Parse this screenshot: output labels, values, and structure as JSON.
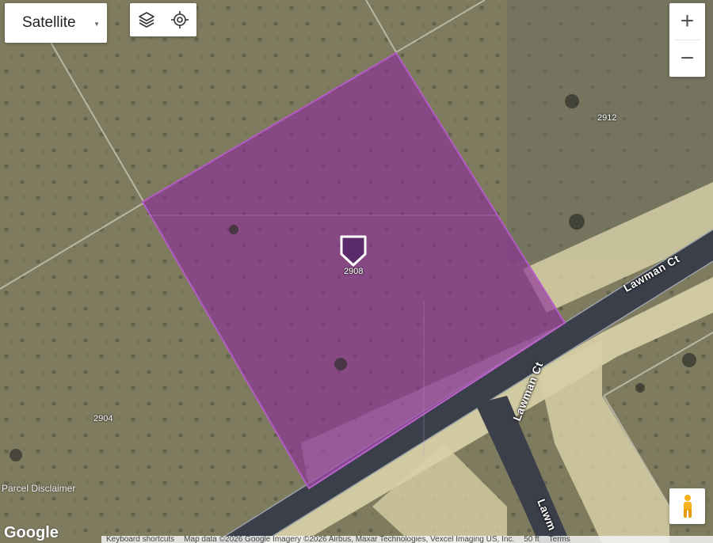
{
  "map_type": {
    "label": "Satellite"
  },
  "icons": {
    "layers": "layers-icon",
    "locate": "my-location-icon",
    "zoom_in": "plus-icon",
    "zoom_out": "minus-icon",
    "street_view": "pegman-icon",
    "marker": "home-marker-icon",
    "caret": "caret-down-icon"
  },
  "zoom": {
    "in_label": "+",
    "out_label": "−"
  },
  "parcels": {
    "selected": "2908",
    "north": "2912",
    "southwest": "2904"
  },
  "roads": {
    "primary": "Lawman Ct",
    "secondary": "Lawman Ct",
    "lower": "Lawm"
  },
  "parcel_disclaimer": "Parcel Disclaimer",
  "footer": {
    "keyboard": "Keyboard shortcuts",
    "attribution": "Map data ©2026 Google Imagery ©2026 Airbus, Maxar Technologies, Vexcel Imaging US, Inc.",
    "scale": "50 ft",
    "terms": "Terms"
  },
  "logo": "Google",
  "colors": {
    "parcel_fill": "#8a2a9a",
    "parcel_stroke": "#b45cc4",
    "marker": "#5a2a6a",
    "road": "#3a3f49"
  }
}
